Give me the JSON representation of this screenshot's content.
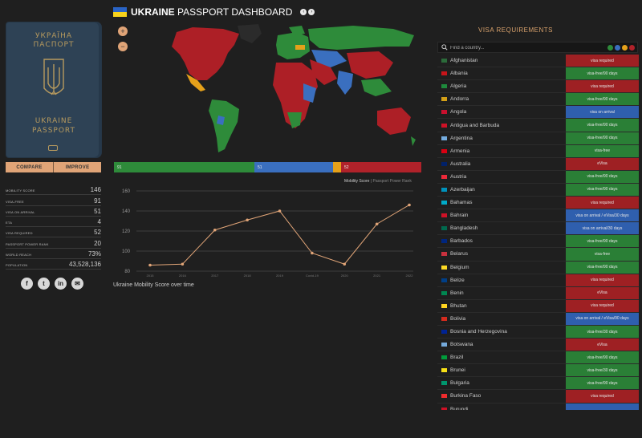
{
  "header": {
    "title_bold": "UKRAINE",
    "title_rest": " PASSPORT DASHBOARD"
  },
  "passport": {
    "line1": "УКРАЇНА",
    "line2": "ПАСПОРТ",
    "line3": "UKRAINE",
    "line4": "PASSPORT"
  },
  "buttons": {
    "compare": "COMPARE",
    "improve": "IMPROVE"
  },
  "stats": [
    {
      "label": "Mobility score",
      "value": "146"
    },
    {
      "label": "Visa-free",
      "value": "91"
    },
    {
      "label": "Visa on arrival",
      "value": "51"
    },
    {
      "label": "eTA",
      "value": "4"
    },
    {
      "label": "Visa required",
      "value": "52"
    },
    {
      "label": "Passport power rank",
      "value": "20"
    },
    {
      "label": "World reach",
      "value": "73%"
    },
    {
      "label": "Population",
      "value": "43,528,136"
    }
  ],
  "zoom": {
    "in": "+",
    "out": "−"
  },
  "mobility_bar": [
    {
      "value": "91",
      "color": "#2e8b3a",
      "share": 91
    },
    {
      "value": "51",
      "color": "#3a6fbf",
      "share": 51
    },
    {
      "value": "",
      "color": "#e5a11a",
      "share": 4
    },
    {
      "value": "52",
      "color": "#b0222a",
      "share": 52
    }
  ],
  "chart_legend": {
    "main": "Mobility Score",
    "sub": " | Passport Power Rank"
  },
  "chart_caption": "Ukraine Mobility Score over time",
  "chart_data": {
    "type": "line",
    "title": "Ukraine Mobility Score over time",
    "x": [
      "2015",
      "2016",
      "2017",
      "2018",
      "2019",
      "Covid-19",
      "2020",
      "2021",
      "2022"
    ],
    "yticks": [
      "80",
      "100",
      "120",
      "140",
      "160"
    ],
    "ylim": [
      80,
      160
    ],
    "series": [
      {
        "name": "Mobility Score",
        "values": [
          86,
          87,
          121,
          131,
          140,
          98,
          87,
          127,
          146
        ]
      }
    ],
    "grid": true
  },
  "visa": {
    "title": "VISA REQUIREMENTS",
    "search_placeholder": "Find a country...",
    "filter_colors": [
      "#2e8b3a",
      "#3a6fbf",
      "#e5a11a",
      "#b0222a"
    ],
    "colors": {
      "required": "#9e2023",
      "free": "#2a7f36",
      "arrival": "#2f5fae"
    },
    "rows": [
      {
        "country": "Afghanistan",
        "status": "visa required",
        "kind": "required",
        "flag": "#2b6b3a"
      },
      {
        "country": "Albania",
        "status": "visa-free/90 days",
        "kind": "free",
        "flag": "#c7141a"
      },
      {
        "country": "Algeria",
        "status": "visa required",
        "kind": "required",
        "flag": "#1e8a3c"
      },
      {
        "country": "Andorra",
        "status": "visa-free/90 days",
        "kind": "free",
        "flag": "#d4a017"
      },
      {
        "country": "Angola",
        "status": "visa on arrival",
        "kind": "arrival",
        "flag": "#c8102e"
      },
      {
        "country": "Antigua and Barbuda",
        "status": "visa-free/90 days",
        "kind": "free",
        "flag": "#ce1126"
      },
      {
        "country": "Argentina",
        "status": "visa-free/90 days",
        "kind": "free",
        "flag": "#74acdf"
      },
      {
        "country": "Armenia",
        "status": "visa-free",
        "kind": "free",
        "flag": "#d90012"
      },
      {
        "country": "Australia",
        "status": "eVisa",
        "kind": "required",
        "flag": "#012169"
      },
      {
        "country": "Austria",
        "status": "visa-free/90 days",
        "kind": "free",
        "flag": "#ed2939"
      },
      {
        "country": "Azerbaijan",
        "status": "visa-free/90 days",
        "kind": "free",
        "flag": "#0092bc"
      },
      {
        "country": "Bahamas",
        "status": "visa required",
        "kind": "required",
        "flag": "#00abc9"
      },
      {
        "country": "Bahrain",
        "status": "visa on arrival / eVisa/30 days",
        "kind": "arrival",
        "flag": "#ce1126"
      },
      {
        "country": "Bangladesh",
        "status": "visa on arrival/30 days",
        "kind": "arrival",
        "flag": "#006a4e"
      },
      {
        "country": "Barbados",
        "status": "visa-free/90 days",
        "kind": "free",
        "flag": "#00267f"
      },
      {
        "country": "Belarus",
        "status": "visa-free",
        "kind": "free",
        "flag": "#c8313e"
      },
      {
        "country": "Belgium",
        "status": "visa-free/90 days",
        "kind": "free",
        "flag": "#fdda24"
      },
      {
        "country": "Belize",
        "status": "visa required",
        "kind": "required",
        "flag": "#003f87"
      },
      {
        "country": "Benin",
        "status": "eVisa",
        "kind": "required",
        "flag": "#008751"
      },
      {
        "country": "Bhutan",
        "status": "visa required",
        "kind": "required",
        "flag": "#ffd520"
      },
      {
        "country": "Bolivia",
        "status": "visa on arrival / eVisa/90 days",
        "kind": "arrival",
        "flag": "#d52b1e"
      },
      {
        "country": "Bosnia and Herzegovina",
        "status": "visa-free/30 days",
        "kind": "free",
        "flag": "#002395"
      },
      {
        "country": "Botswana",
        "status": "eVisa",
        "kind": "required",
        "flag": "#75aadb"
      },
      {
        "country": "Brazil",
        "status": "visa-free/90 days",
        "kind": "free",
        "flag": "#009c3b"
      },
      {
        "country": "Brunei",
        "status": "visa-free/30 days",
        "kind": "free",
        "flag": "#f7e017"
      },
      {
        "country": "Bulgaria",
        "status": "visa-free/90 days",
        "kind": "free",
        "flag": "#00966e"
      },
      {
        "country": "Burkina Faso",
        "status": "visa required",
        "kind": "required",
        "flag": "#ef2b2d"
      },
      {
        "country": "Burundi",
        "status": "",
        "kind": "arrival",
        "flag": "#ce1126"
      }
    ]
  }
}
